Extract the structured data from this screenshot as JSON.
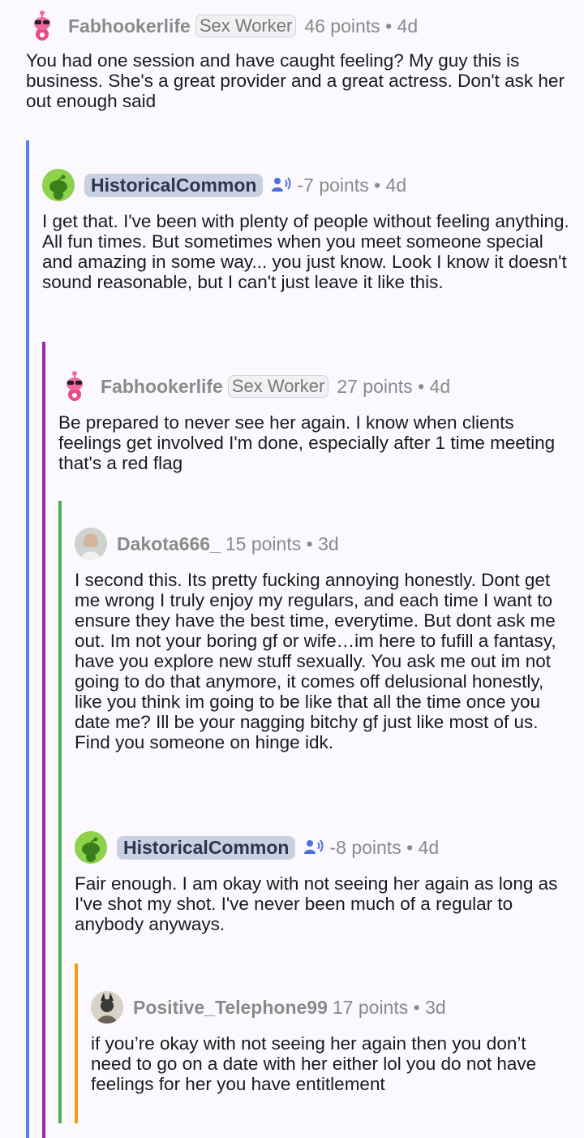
{
  "accent_colors": {
    "level1": "#4f86ec",
    "level2": "#9c27b0",
    "level3": "#4caf50",
    "level4": "#f39c12"
  },
  "comments": [
    {
      "username": "Fabhookerlife",
      "flair": "Sex Worker",
      "points": "46 points",
      "age": "4d",
      "body": "You had one session and have caught feeling? My guy this is business. She's a great provider and a great actress. Don't ask her out enough said",
      "avatar_icon": "pink-snoo-sunglasses-icon"
    },
    {
      "username": "HistoricalCommon",
      "points": "-7 points",
      "age": "4d",
      "body": "I get that. I've been with plenty of people without feeling anything. All fun times. But sometimes when you meet someone special and amazing in some way... you just know. Look I know it doesn't sound reasonable, but I can't just leave it like this.",
      "avatar_icon": "green-snoo-icon",
      "badge_icon": "op-speaker-icon"
    },
    {
      "username": "Fabhookerlife",
      "flair": "Sex Worker",
      "points": "27 points",
      "age": "4d",
      "body": "Be prepared to never see her again. I know when clients feelings get involved I'm done, especially after 1 time meeting that's a red flag",
      "avatar_icon": "pink-snoo-sunglasses-icon"
    },
    {
      "username": "Dakota666_",
      "points": "15 points",
      "age": "3d",
      "body": "I second this. Its pretty fucking annoying honestly. Dont get me wrong I truly enjoy my regulars, and each time I want to ensure they have the best time, everytime. But dont ask me out. Im not your boring gf or wife…im here to fufill a fantasy, have you explore new stuff sexually. You ask me out im not going to do that anymore, it comes off delusional honestly, like you think im going to be like that all the time once you date me? Ill be your nagging bitchy gf just like most of us. Find you someone on hinge idk.",
      "avatar_icon": "photo-avatar-icon"
    },
    {
      "username": "HistoricalCommon",
      "points": "-8 points",
      "age": "4d",
      "body": "Fair enough. I am okay with not seeing her again as long as I've shot my shot. I've never been much of a regular to anybody anyways.",
      "avatar_icon": "green-snoo-icon",
      "badge_icon": "op-speaker-icon"
    },
    {
      "username": "Positive_Telephone99",
      "points": "17 points",
      "age": "3d",
      "body": "if you’re okay with not seeing her again then you don’t need to go on a date with her either lol you do not have feelings for her you have entitlement",
      "avatar_icon": "photo-avatar-icon"
    }
  ]
}
